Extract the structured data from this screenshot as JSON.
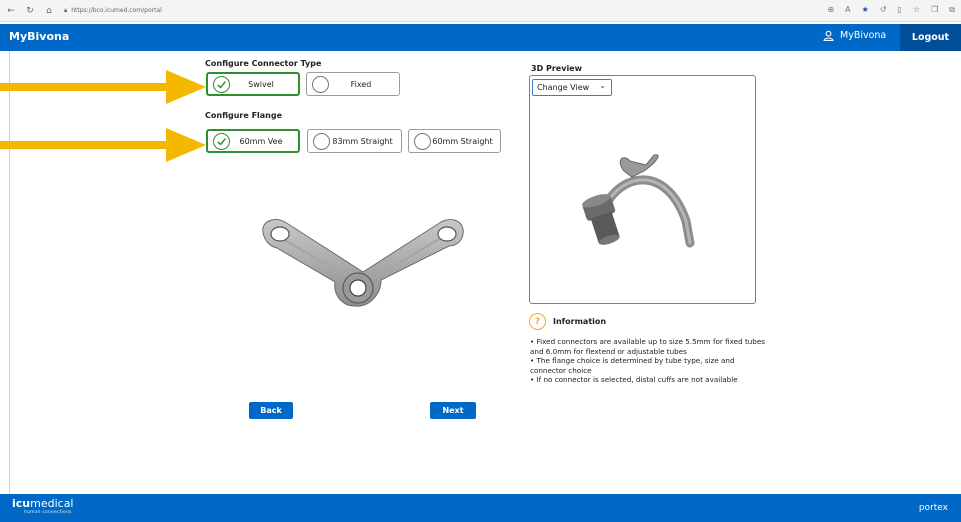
{
  "browser": {
    "url": "https://bco.icumed.com/portal",
    "nav_icons": [
      "back-icon",
      "refresh-icon",
      "home-icon"
    ],
    "toolbar_icons": [
      "zoom-icon",
      "read-aloud-icon",
      "favorite-star-icon",
      "refresh-icon",
      "split-view-icon",
      "favorites-icon",
      "collections-icon",
      "extensions-icon"
    ]
  },
  "header": {
    "brand": "MyBivona",
    "user_label": "MyBivona",
    "logout_label": "Logout",
    "accent": "#0069c8"
  },
  "connector": {
    "title": "Configure Connector Type",
    "options": [
      {
        "label": "Swivel",
        "selected": true
      },
      {
        "label": "Fixed",
        "selected": false
      }
    ]
  },
  "flange": {
    "title": "Configure Flange",
    "options": [
      {
        "label": "60mm Vee",
        "selected": true
      },
      {
        "label": "83mm Straight",
        "selected": false
      },
      {
        "label": "60mm Straight",
        "selected": false
      }
    ]
  },
  "preview": {
    "title": "3D Preview",
    "view_select": "Change View"
  },
  "info": {
    "title": "Information",
    "lines": [
      "• Fixed connectors are available up to size 5.5mm for fixed tubes and 6.0mm for flextend or adjustable tubes",
      "• The flange choice is determined by tube type, size and connector choice",
      "• If no connector is selected, distal cuffs are not available"
    ]
  },
  "actions": {
    "back": "Back",
    "next": "Next"
  },
  "footer": {
    "logo_strong": "icu",
    "logo_light": "medical",
    "tagline": "human connections",
    "brand_right": "portex"
  },
  "colors": {
    "selected_border": "#2f8f2f",
    "arrow": "#f5b800",
    "info_icon": "#f5a623"
  }
}
